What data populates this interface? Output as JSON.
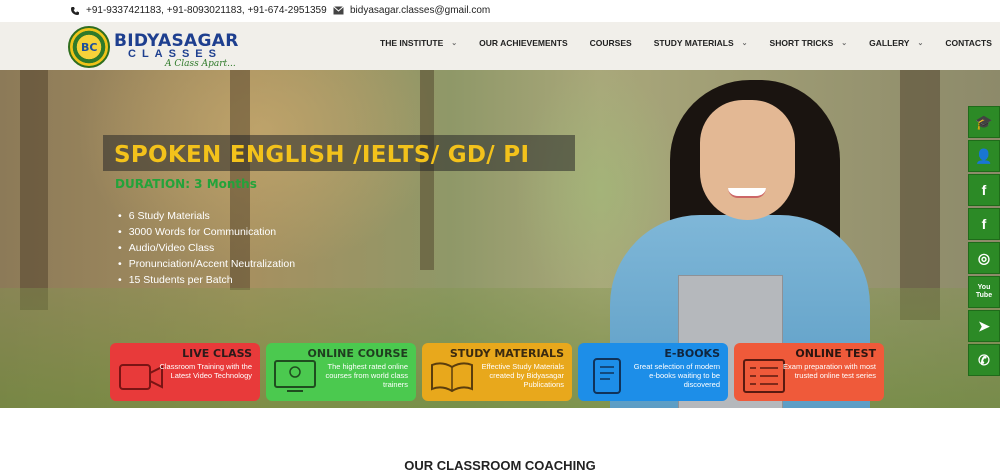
{
  "topbar": {
    "phone": "+91-9337421183, +91-8093021183, +91-674-2951359",
    "email": "bidyasagar.classes@gmail.com"
  },
  "logo": {
    "badge": "BC",
    "name": "BIDYASAGAR",
    "sub": "CLASSES",
    "tagline": "A Class Apart..."
  },
  "nav": [
    {
      "label": "THE INSTITUTE",
      "has_dropdown": true
    },
    {
      "label": "OUR ACHIEVEMENTS",
      "has_dropdown": false
    },
    {
      "label": "COURSES",
      "has_dropdown": false
    },
    {
      "label": "STUDY MATERIALS",
      "has_dropdown": true
    },
    {
      "label": "SHORT TRICKS",
      "has_dropdown": true
    },
    {
      "label": "GALLERY",
      "has_dropdown": true
    },
    {
      "label": "CONTACTS",
      "has_dropdown": true
    }
  ],
  "hero": {
    "title": "SPOKEN ENGLISH /IELTS/ GD/ PI",
    "duration": "DURATION: 3 Months",
    "features": [
      "6 Study Materials",
      "3000 Words for Communication",
      "Audio/Video Class",
      "Pronunciation/Accent Neutralization",
      "15 Students per Batch"
    ]
  },
  "cards": [
    {
      "title": "LIVE CLASS",
      "desc": "Classroom Training with the Latest Video Technology",
      "bg": "#e83a3a",
      "title_color": "#2b1a1a",
      "icon": "video-camera-icon"
    },
    {
      "title": "ONLINE COURSE",
      "desc": "The highest rated online courses from world class trainers",
      "bg": "#4bc94f",
      "title_color": "#1f3d1f",
      "icon": "monitor-icon"
    },
    {
      "title": "STUDY MATERIALS",
      "desc": "Effective Study Materials created by Bidyasagar Publications",
      "bg": "#e8a81c",
      "title_color": "#3a2a10",
      "icon": "book-icon"
    },
    {
      "title": "E-BOOKS",
      "desc": "Great selection of modern e-books waiting to be discovered",
      "bg": "#1d8ee8",
      "title_color": "#10263f",
      "icon": "tablet-icon"
    },
    {
      "title": "ONLINE TEST",
      "desc": "Exam preparation with most trusted online test series",
      "bg": "#ef5a3a",
      "title_color": "#2b1510",
      "icon": "test-sheet-icon"
    }
  ],
  "social": [
    {
      "name": "graduation-cap-icon",
      "glyph": "🎓"
    },
    {
      "name": "user-icon",
      "glyph": "👤"
    },
    {
      "name": "facebook-icon",
      "glyph": "f"
    },
    {
      "name": "facebook-square-icon",
      "glyph": "f"
    },
    {
      "name": "instagram-icon",
      "glyph": "◎"
    },
    {
      "name": "youtube-icon",
      "glyph": "You Tube"
    },
    {
      "name": "telegram-icon",
      "glyph": "➤"
    },
    {
      "name": "whatsapp-icon",
      "glyph": "✆"
    }
  ],
  "section_title": "OUR CLASSROOM COACHING"
}
